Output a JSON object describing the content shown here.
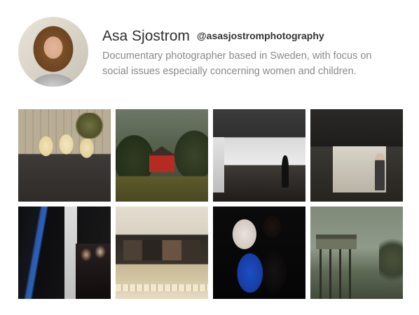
{
  "profile": {
    "name": "Asa Sjostrom",
    "handle": "@asasjostromphotography",
    "bio": "Documentary photographer based in Sweden, with focus on social issues especially concerning women and children."
  },
  "photos": [
    {
      "subject": "three-girls-wooden-wall"
    },
    {
      "subject": "red-cottage-forest"
    },
    {
      "subject": "gallery-hallway"
    },
    {
      "subject": "dark-gallery-visitor"
    },
    {
      "subject": "exhibition-crowd"
    },
    {
      "subject": "subway-photo-exhibit"
    },
    {
      "subject": "two-women-night"
    },
    {
      "subject": "lookout-tower-fog"
    }
  ],
  "colors": {
    "name": "#2f2f2f",
    "bio": "#8a8a8a",
    "background": "#ffffff"
  }
}
